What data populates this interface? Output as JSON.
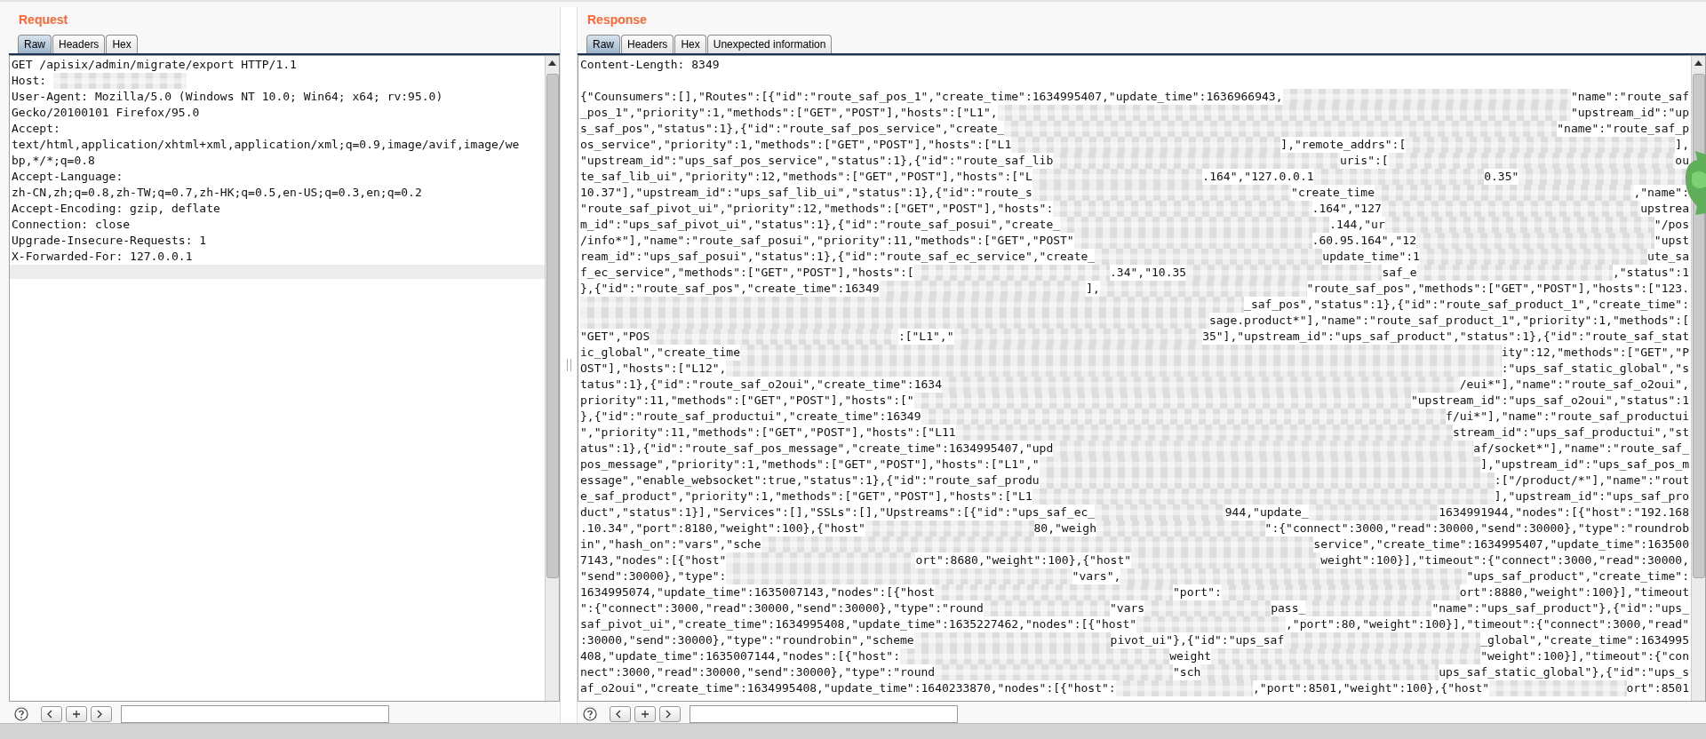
{
  "request": {
    "title": "Request",
    "tabs": [
      {
        "label": "Raw",
        "selected": true
      },
      {
        "label": "Headers",
        "selected": false
      },
      {
        "label": "Hex",
        "selected": false
      }
    ],
    "lines": [
      [
        {
          "kind": "text",
          "text": "GET /apisix/admin/migrate/export HTTP/1.1"
        }
      ],
      [
        {
          "kind": "text",
          "text": "Host: "
        },
        {
          "kind": "redacted"
        }
      ],
      [
        {
          "kind": "text",
          "text": "User-Agent: Mozilla/5.0 (Windows NT 10.0; Win64; x64; rv:95.0)"
        }
      ],
      [
        {
          "kind": "text",
          "text": "Gecko/20100101 Firefox/95.0"
        }
      ],
      [
        {
          "kind": "text",
          "text": "Accept:"
        }
      ],
      [
        {
          "kind": "text",
          "text": "text/html,application/xhtml+xml,application/xml;q=0.9,image/avif,image/we"
        }
      ],
      [
        {
          "kind": "text",
          "text": "bp,*/*;q=0.8"
        }
      ],
      [
        {
          "kind": "text",
          "text": "Accept-Language:"
        }
      ],
      [
        {
          "kind": "text",
          "text": "zh-CN,zh;q=0.8,zh-TW;q=0.7,zh-HK;q=0.5,en-US;q=0.3,en;q=0.2"
        }
      ],
      [
        {
          "kind": "text",
          "text": "Accept-Encoding: gzip, deflate"
        }
      ],
      [
        {
          "kind": "text",
          "text": "Connection: close"
        }
      ],
      [
        {
          "kind": "text",
          "text": "Upgrade-Insecure-Requests: 1"
        }
      ],
      [
        {
          "kind": "text",
          "text": "X-Forwarded-For: 127.0.0.1"
        }
      ]
    ]
  },
  "response": {
    "title": "Response",
    "tabs": [
      {
        "label": "Raw",
        "selected": true
      },
      {
        "label": "Headers",
        "selected": false
      },
      {
        "label": "Hex",
        "selected": false
      },
      {
        "label": "Unexpected information",
        "selected": false
      }
    ],
    "header_lines": [
      [
        {
          "kind": "text",
          "text": "Content-Length: 8349"
        }
      ]
    ],
    "body_lines": [
      [
        {
          "kind": "text",
          "text": "{\"Counsumers\":[],\"Routes\":[{\"id\":\"route_saf_pos_1\",\"create_time\":1634995407,\"update_time\":1636966943,"
        },
        {
          "kind": "redacted"
        },
        {
          "kind": "text",
          "text": "\"name\":\"route_saf"
        }
      ],
      [
        {
          "kind": "text",
          "text": "_pos_1\",\"priority\":1,\"methods\":[\"GET\",\"POST\"],\"hosts\":[\"L1\","
        },
        {
          "kind": "redacted"
        },
        {
          "kind": "text",
          "text": "\"upstream_id\":\"up"
        }
      ],
      [
        {
          "kind": "text",
          "text": "s_saf_pos\",\"status\":1},{\"id\":\"route_saf_pos_service\",\"create_"
        },
        {
          "kind": "redacted"
        },
        {
          "kind": "text",
          "text": "\"name\":\"route_saf_p"
        }
      ],
      [
        {
          "kind": "text",
          "text": "os_service\",\"priority\":1,\"methods\":[\"GET\",\"POST\"],\"hosts\":[\"L1"
        },
        {
          "kind": "redacted"
        },
        {
          "kind": "text",
          "text": "],\"remote_addrs\":["
        },
        {
          "kind": "redacted"
        },
        {
          "kind": "text",
          "text": "],"
        }
      ],
      [
        {
          "kind": "text",
          "text": "\"upstream_id\":\"ups_saf_pos_service\",\"status\":1},{\"id\":\"route_saf_lib"
        },
        {
          "kind": "redacted"
        },
        {
          "kind": "text",
          "text": "uris\":["
        },
        {
          "kind": "redacted"
        },
        {
          "kind": "text",
          "text": "ou"
        }
      ],
      [
        {
          "kind": "text",
          "text": "te_saf_lib_ui\",\"priority\":12,\"methods\":[\"GET\",\"POST\"],\"hosts\":[\"L"
        },
        {
          "kind": "redacted"
        },
        {
          "kind": "text",
          "text": ".164\",\"127.0.0.1"
        },
        {
          "kind": "redacted"
        },
        {
          "kind": "text",
          "text": "0.35\""
        },
        {
          "kind": "redacted"
        }
      ],
      [
        {
          "kind": "text",
          "text": "10.37\"],\"upstream_id\":\"ups_saf_lib_ui\",\"status\":1},{\"id\":\"route_s"
        },
        {
          "kind": "redacted"
        },
        {
          "kind": "text",
          "text": "\"create_time"
        },
        {
          "kind": "redacted"
        },
        {
          "kind": "text",
          "text": ",\"name\":"
        }
      ],
      [
        {
          "kind": "text",
          "text": "\"route_saf_pivot_ui\",\"priority\":12,\"methods\":[\"GET\",\"POST\"],\"hosts\":"
        },
        {
          "kind": "redacted"
        },
        {
          "kind": "text",
          "text": ".164\",\"127"
        },
        {
          "kind": "redacted"
        },
        {
          "kind": "text",
          "text": "upstrea"
        }
      ],
      [
        {
          "kind": "text",
          "text": "m_id\":\"ups_saf_pivot_ui\",\"status\":1},{\"id\":\"route_saf_posui\",\"create_"
        },
        {
          "kind": "redacted"
        },
        {
          "kind": "text",
          "text": ".144,\"ur"
        },
        {
          "kind": "redacted"
        },
        {
          "kind": "text",
          "text": "\"/pos"
        }
      ],
      [
        {
          "kind": "text",
          "text": "/info*\"],\"name\":\"route_saf_posui\",\"priority\":11,\"methods\":[\"GET\",\"POST\""
        },
        {
          "kind": "redacted"
        },
        {
          "kind": "text",
          "text": ".60.95.164\",\"12"
        },
        {
          "kind": "redacted"
        },
        {
          "kind": "text",
          "text": "\"upst"
        }
      ],
      [
        {
          "kind": "text",
          "text": "ream_id\":\"ups_saf_posui\",\"status\":1},{\"id\":\"route_saf_ec_service\",\"create_"
        },
        {
          "kind": "redacted"
        },
        {
          "kind": "text",
          "text": "update_time\":1"
        },
        {
          "kind": "redacted"
        },
        {
          "kind": "text",
          "text": "ute_sa"
        }
      ],
      [
        {
          "kind": "text",
          "text": "f_ec_service\",\"methods\":[\"GET\",\"POST\"],\"hosts\":["
        },
        {
          "kind": "redacted"
        },
        {
          "kind": "text",
          "text": ".34\",\"10.35"
        },
        {
          "kind": "redacted"
        },
        {
          "kind": "text",
          "text": "saf_e"
        },
        {
          "kind": "redacted"
        },
        {
          "kind": "text",
          "text": ",\"status\":1"
        }
      ],
      [
        {
          "kind": "text",
          "text": "},{\"id\":\"route_saf_pos\",\"create_time\":16349"
        },
        {
          "kind": "redacted"
        },
        {
          "kind": "text",
          "text": "],"
        },
        {
          "kind": "redacted"
        },
        {
          "kind": "text",
          "text": "\"route_saf_pos\",\"methods\":[\"GET\",\"POST\"],\"hosts\":[\"123."
        }
      ],
      [
        {
          "kind": "redacted"
        },
        {
          "kind": "text",
          "text": "_saf_pos\",\"status\":1},{\"id\":\"route_saf_product_1\",\"create_time\":"
        }
      ],
      [
        {
          "kind": "redacted"
        },
        {
          "kind": "text",
          "text": "sage.product*\"],\"name\":\"route_saf_product_1\",\"priority\":1,\"methods\":["
        }
      ],
      [
        {
          "kind": "text",
          "text": "\"GET\",\"POS"
        },
        {
          "kind": "redacted"
        },
        {
          "kind": "text",
          "text": ":[\"L1\",\""
        },
        {
          "kind": "redacted"
        },
        {
          "kind": "text",
          "text": "35\"],\"upstream_id\":\"ups_saf_product\",\"status\":1},{\"id\":\"route_saf_stat"
        }
      ],
      [
        {
          "kind": "text",
          "text": "ic_global\",\"create_time"
        },
        {
          "kind": "redacted"
        },
        {
          "kind": "text",
          "text": "ity\":12,\"methods\":[\"GET\",\"P"
        }
      ],
      [
        {
          "kind": "text",
          "text": "OST\"],\"hosts\":[\"L12\","
        },
        {
          "kind": "redacted"
        },
        {
          "kind": "text",
          "text": ":\"ups_saf_static_global\",\"s"
        }
      ],
      [
        {
          "kind": "text",
          "text": "tatus\":1},{\"id\":\"route_saf_o2oui\",\"create_time\":1634"
        },
        {
          "kind": "redacted"
        },
        {
          "kind": "text",
          "text": "/eui*\"],\"name\":\"route_saf_o2oui\","
        }
      ],
      [
        {
          "kind": "text",
          "text": "priority\":11,\"methods\":[\"GET\",\"POST\"],\"hosts\":[\""
        },
        {
          "kind": "redacted"
        },
        {
          "kind": "text",
          "text": "\"upstream_id\":\"ups_saf_o2oui\",\"status\":1"
        }
      ],
      [
        {
          "kind": "text",
          "text": "},{\"id\":\"route_saf_productui\",\"create_time\":16349"
        },
        {
          "kind": "redacted"
        },
        {
          "kind": "text",
          "text": "f/ui*\"],\"name\":\"route_saf_productui"
        }
      ],
      [
        {
          "kind": "text",
          "text": "\",\"priority\":11,\"methods\":[\"GET\",\"POST\"],\"hosts\":[\"L11"
        },
        {
          "kind": "redacted"
        },
        {
          "kind": "text",
          "text": "stream_id\":\"ups_saf_productui\",\"st"
        }
      ],
      [
        {
          "kind": "text",
          "text": "atus\":1},{\"id\":\"route_saf_pos_message\",\"create_time\":1634995407,\"upd"
        },
        {
          "kind": "redacted"
        },
        {
          "kind": "text",
          "text": "af/socket*\"],\"name\":\"route_saf_"
        }
      ],
      [
        {
          "kind": "text",
          "text": "pos_message\",\"priority\":1,\"methods\":[\"GET\",\"POST\"],\"hosts\":[\"L1\",\""
        },
        {
          "kind": "redacted"
        },
        {
          "kind": "text",
          "text": "],\"upstream_id\":\"ups_saf_pos_m"
        }
      ],
      [
        {
          "kind": "text",
          "text": "essage\",\"enable_websocket\":true,\"status\":1},{\"id\":\"route_saf_produ"
        },
        {
          "kind": "redacted"
        },
        {
          "kind": "text",
          "text": ":[\"/product/*\"],\"name\":\"rout"
        }
      ],
      [
        {
          "kind": "text",
          "text": "e_saf_product\",\"priority\":1,\"methods\":[\"GET\",\"POST\"],\"hosts\":[\"L1"
        },
        {
          "kind": "redacted"
        },
        {
          "kind": "text",
          "text": "],\"upstream_id\":\"ups_saf_pro"
        }
      ],
      [
        {
          "kind": "text",
          "text": "duct\",\"status\":1}],\"Services\":[],\"SSLs\":[],\"Upstreams\":[{\"id\":\"ups_saf_ec_"
        },
        {
          "kind": "redacted"
        },
        {
          "kind": "text",
          "text": "944,\"update_"
        },
        {
          "kind": "redacted"
        },
        {
          "kind": "text",
          "text": "1634991944,\"nodes\":[{\"host\":\"192.168"
        }
      ],
      [
        {
          "kind": "text",
          "text": ".10.34\",\"port\":8180,\"weight\":100},{\"host\""
        },
        {
          "kind": "redacted"
        },
        {
          "kind": "text",
          "text": "80,\"weigh"
        },
        {
          "kind": "redacted"
        },
        {
          "kind": "text",
          "text": "\":{\"connect\":3000,\"read\":30000,\"send\":30000},\"type\":\"roundrob"
        }
      ],
      [
        {
          "kind": "text",
          "text": "in\",\"hash_on\":\"vars\",\"sche"
        },
        {
          "kind": "redacted"
        },
        {
          "kind": "text",
          "text": "service\",\"create_time\":1634995407,\"update_time\":163500"
        }
      ],
      [
        {
          "kind": "text",
          "text": "7143,\"nodes\":[{\"host\""
        },
        {
          "kind": "redacted"
        },
        {
          "kind": "text",
          "text": "ort\":8680,\"weight\":100},{\"host\""
        },
        {
          "kind": "redacted"
        },
        {
          "kind": "text",
          "text": "weight\":100}],\"timeout\":{\"connect\":3000,\"read\":30000,"
        }
      ],
      [
        {
          "kind": "text",
          "text": "\"send\":30000},\"type\":"
        },
        {
          "kind": "redacted"
        },
        {
          "kind": "text",
          "text": "\"vars\","
        },
        {
          "kind": "redacted"
        },
        {
          "kind": "text",
          "text": "\"ups_saf_product\",\"create_time\":"
        }
      ],
      [
        {
          "kind": "text",
          "text": "1634995074,\"update_time\":1635007143,\"nodes\":[{\"host"
        },
        {
          "kind": "redacted"
        },
        {
          "kind": "text",
          "text": "\"port\":"
        },
        {
          "kind": "redacted"
        },
        {
          "kind": "text",
          "text": "ort\":8880,\"weight\":100}],\"timeout"
        }
      ],
      [
        {
          "kind": "text",
          "text": "\":{\"connect\":3000,\"read\":30000,\"send\":30000},\"type\":\"round"
        },
        {
          "kind": "redacted"
        },
        {
          "kind": "text",
          "text": "\"vars"
        },
        {
          "kind": "redacted"
        },
        {
          "kind": "text",
          "text": "pass_"
        },
        {
          "kind": "redacted"
        },
        {
          "kind": "text",
          "text": "\"name\":\"ups_saf_product\"},{\"id\":\"ups_"
        }
      ],
      [
        {
          "kind": "text",
          "text": "saf_pivot_ui\",\"create_time\":1634995408,\"update_time\":1635227462,\"nodes\":[{\"host\""
        },
        {
          "kind": "redacted"
        },
        {
          "kind": "text",
          "text": ",\"port\":80,\"weight\":100}],\"timeout\":{\"connect\":3000,\"read\""
        }
      ],
      [
        {
          "kind": "text",
          "text": ":30000,\"send\":30000},\"type\":\"roundrobin\",\"scheme"
        },
        {
          "kind": "redacted"
        },
        {
          "kind": "text",
          "text": "pivot_ui\"},{\"id\":\"ups_saf"
        },
        {
          "kind": "redacted"
        },
        {
          "kind": "text",
          "text": "_global\",\"create_time\":1634995"
        }
      ],
      [
        {
          "kind": "text",
          "text": "408,\"update_time\":1635007144,\"nodes\":[{\"host\":"
        },
        {
          "kind": "redacted"
        },
        {
          "kind": "text",
          "text": "weight"
        },
        {
          "kind": "redacted"
        },
        {
          "kind": "text",
          "text": "\"weight\":100}],\"timeout\":{\"con"
        }
      ],
      [
        {
          "kind": "text",
          "text": "nect\":3000,\"read\":30000,\"send\":30000},\"type\":\"round"
        },
        {
          "kind": "redacted"
        },
        {
          "kind": "text",
          "text": "\"sch"
        },
        {
          "kind": "redacted"
        },
        {
          "kind": "text",
          "text": "ups_saf_static_global\"},{\"id\":\"ups_s"
        }
      ],
      [
        {
          "kind": "text",
          "text": "af_o2oui\",\"create_time\":1634995408,\"update_time\":1640233870,\"nodes\":[{\"host\":"
        },
        {
          "kind": "redacted"
        },
        {
          "kind": "text",
          "text": ",\"port\":8501,\"weight\":100},{\"host\""
        },
        {
          "kind": "redacted"
        },
        {
          "kind": "text",
          "text": "ort\":8501"
        }
      ]
    ]
  }
}
